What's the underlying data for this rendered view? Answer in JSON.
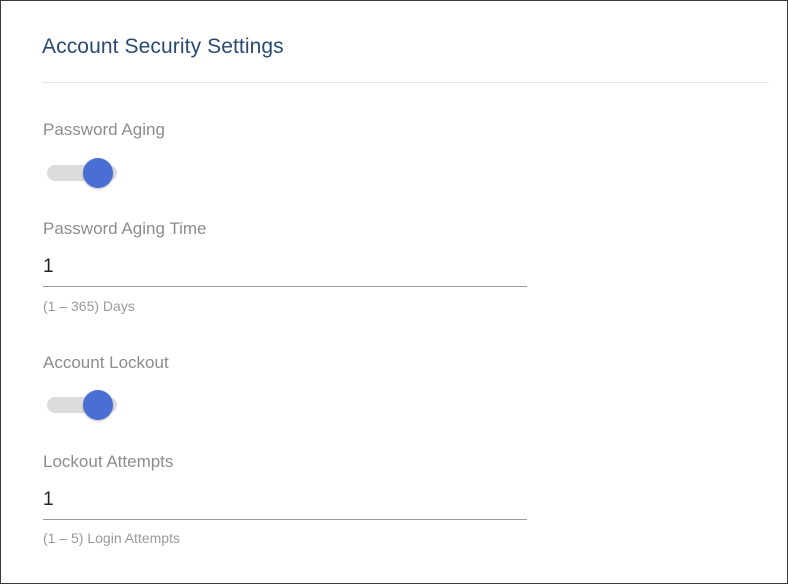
{
  "card": {
    "title": "Account Security Settings"
  },
  "password_aging": {
    "label": "Password Aging",
    "enabled": true,
    "accent": "#4a6fd4"
  },
  "password_aging_time": {
    "label": "Password Aging Time",
    "value": "1",
    "helper": "(1 – 365) Days"
  },
  "account_lockout": {
    "label": "Account Lockout",
    "enabled": true,
    "accent": "#4a6fd4"
  },
  "lockout_attempts": {
    "label": "Lockout Attempts",
    "value": "1",
    "helper": "(1 – 5) Login Attempts"
  }
}
